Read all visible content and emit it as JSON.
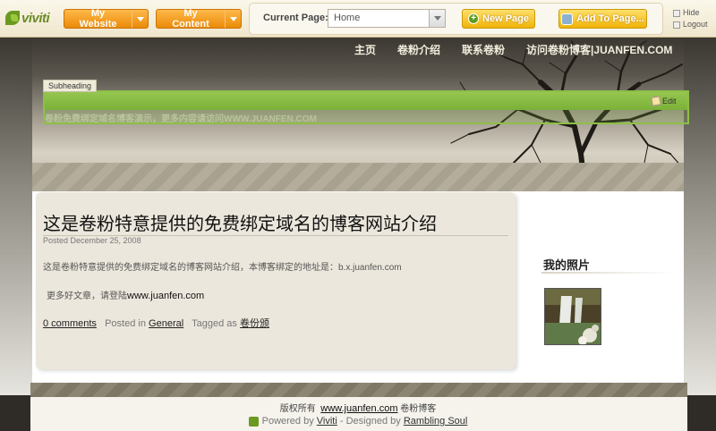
{
  "adminbar": {
    "logo_text": "viviti",
    "my_website": "My Website",
    "my_content": "My Content",
    "current_page_label": "Current Page:",
    "current_page_value": "Home",
    "new_page": "New Page",
    "add_to_page": "Add To Page...",
    "hide": "Hide",
    "logout": "Logout"
  },
  "nav": {
    "items": [
      "主页",
      "卷粉介绍",
      "联系卷粉",
      "访问卷粉博客|JUANFEN.COM"
    ]
  },
  "header": {
    "subheading": "Subheading",
    "edit": "Edit",
    "tagline": "卷粉免费绑定域名博客演示，更多内容请访问WWW.JUANFEN.COM"
  },
  "post": {
    "title": "这是卷粉特意提供的免费绑定域名的博客网站介绍",
    "date": "Posted December 25, 2008",
    "body": "这是卷粉特意提供的免费绑定域名的博客网站介绍，本博客绑定的地址是：b.x.juanfen.com",
    "more_prefix": "更多好文章，请登陆",
    "more_link": "www.juanfen.com",
    "comments": "0 comments",
    "posted_in": "Posted in",
    "category": "General",
    "tagged_as": "Tagged as",
    "tag": "卷份颁"
  },
  "sidebar": {
    "heading": "我的照片"
  },
  "footer": {
    "copyright_prefix": "版权所有",
    "site_link": "www.juanfen.com",
    "site_name": "卷粉博客",
    "powered_by": "Powered by",
    "viviti": "Viviti",
    "designed_by": "- Designed by",
    "designer": "Rambling Soul"
  }
}
